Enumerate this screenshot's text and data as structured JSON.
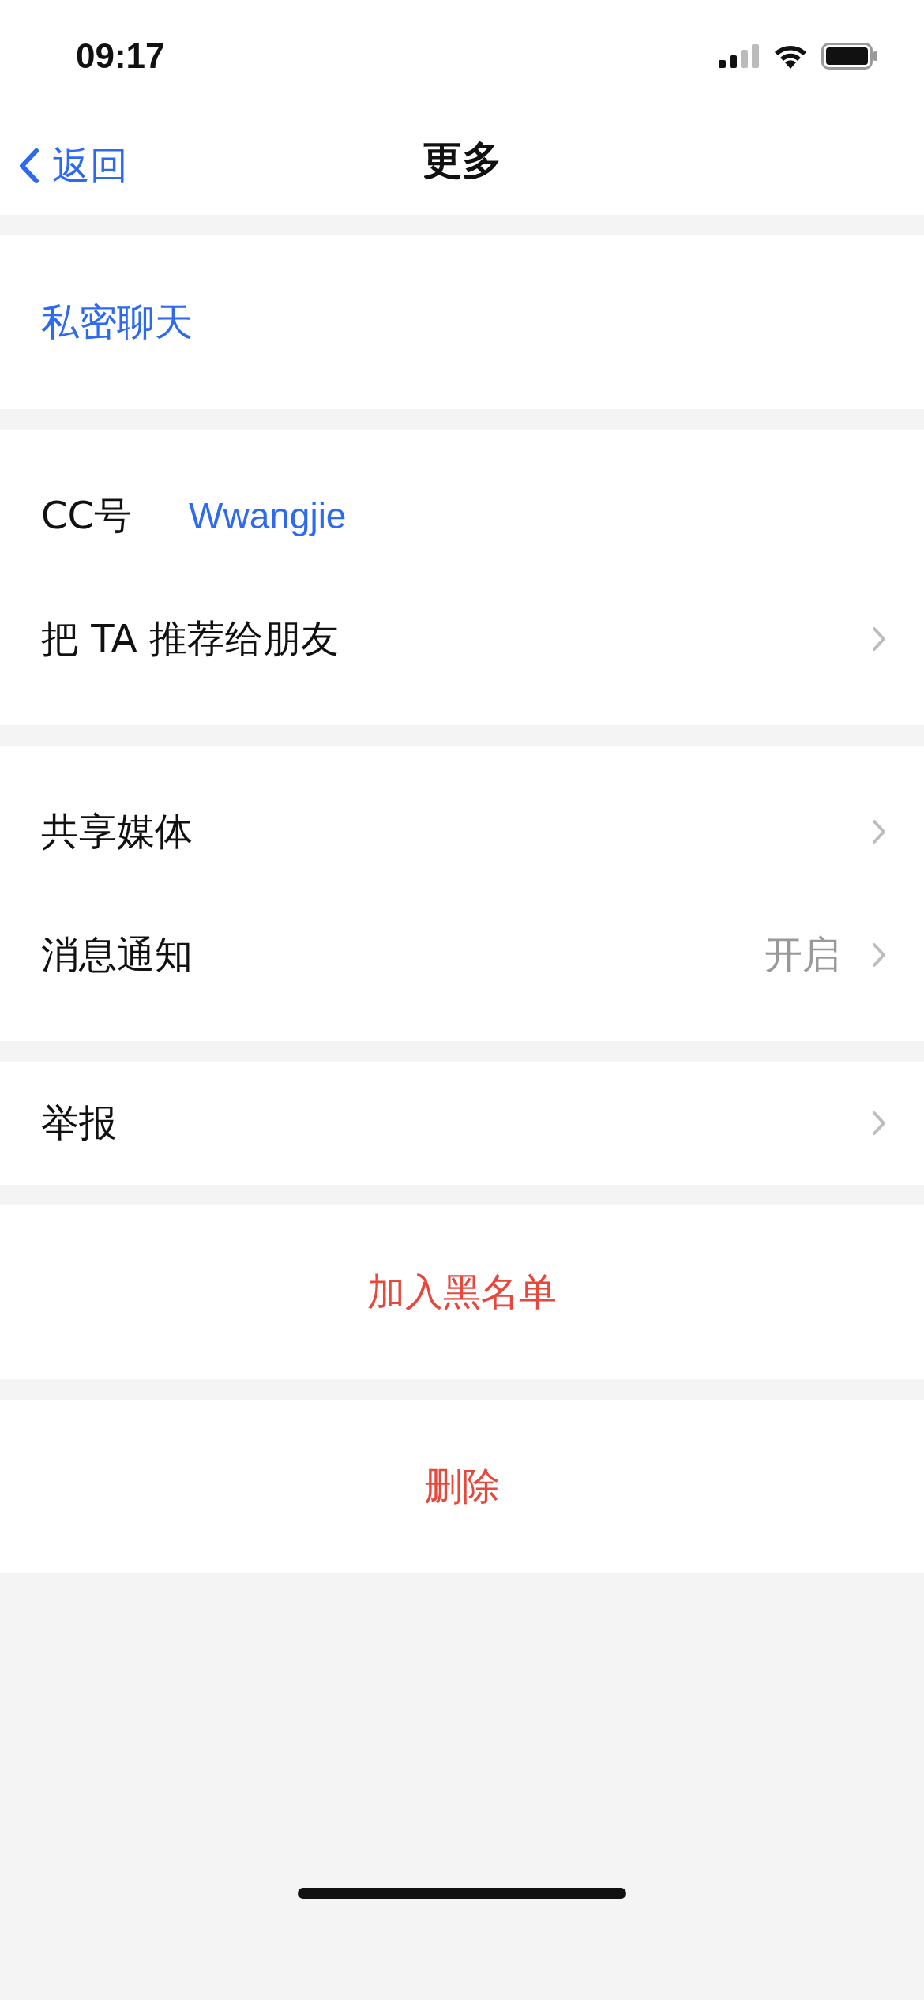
{
  "status_bar": {
    "time": "09:17"
  },
  "nav": {
    "back_label": "返回",
    "title": "更多"
  },
  "sections": [
    {
      "items": [
        {
          "kind": "link",
          "label": "私密聊天"
        }
      ]
    },
    {
      "items": [
        {
          "kind": "info",
          "label": "CC号",
          "value": "Wwangjie"
        },
        {
          "kind": "nav",
          "label": "把 TA 推荐给朋友"
        }
      ]
    },
    {
      "items": [
        {
          "kind": "nav",
          "label": "共享媒体"
        },
        {
          "kind": "nav",
          "label": "消息通知",
          "value": "开启"
        }
      ]
    },
    {
      "items": [
        {
          "kind": "nav",
          "label": "举报"
        }
      ]
    },
    {
      "items": [
        {
          "kind": "danger",
          "label": "加入黑名单"
        }
      ]
    },
    {
      "items": [
        {
          "kind": "danger",
          "label": "删除"
        }
      ]
    }
  ]
}
